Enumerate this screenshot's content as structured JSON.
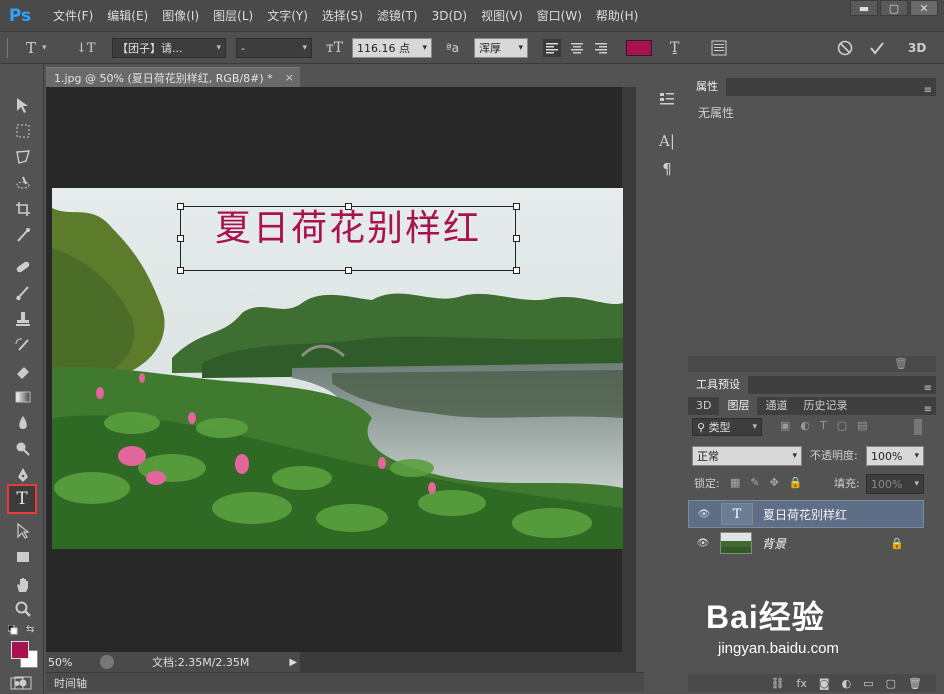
{
  "app": {
    "logo": "Ps"
  },
  "menu": [
    "文件(F)",
    "编辑(E)",
    "图像(I)",
    "图层(L)",
    "文字(Y)",
    "选择(S)",
    "滤镜(T)",
    "3D(D)",
    "视图(V)",
    "窗口(W)",
    "帮助(H)"
  ],
  "window_controls": {
    "minimize": "▬",
    "maximize": "▢",
    "close": "✕"
  },
  "options": {
    "font_family": "【团子】请...",
    "font_style": "-",
    "font_size": "116.16 点",
    "aa_label": "ªa",
    "antialias": "浑厚",
    "text_color": "#a8124f",
    "label_3d": "3D"
  },
  "document": {
    "tab_title": "1.jpg @ 50% (夏日荷花别样红, RGB/8#) *",
    "tab_close": "×",
    "canvas_text": "夏日荷花别样红",
    "zoom": "50%",
    "doc_size": "文档:2.35M/2.35M"
  },
  "timeline": {
    "label": "时间轴"
  },
  "colors": {
    "foreground": "#a8124f",
    "background": "#ffffff"
  },
  "properties_panel": {
    "tab": "属性",
    "content": "无属性"
  },
  "tool_presets": {
    "tab": "工具预设"
  },
  "layers_panel": {
    "tabs": [
      "3D",
      "图层",
      "通道",
      "历史记录"
    ],
    "filter": "类型",
    "blend_mode": "正常",
    "opacity_label": "不透明度:",
    "opacity_value": "100%",
    "lock_label": "锁定:",
    "fill_label": "填充:",
    "fill_value": "100%",
    "layers": [
      {
        "name": "夏日荷花别样红",
        "thumb": "T"
      },
      {
        "name": "背景"
      }
    ]
  },
  "watermark": {
    "logo": "Bai经验",
    "url": "jingyan.baidu.com"
  }
}
